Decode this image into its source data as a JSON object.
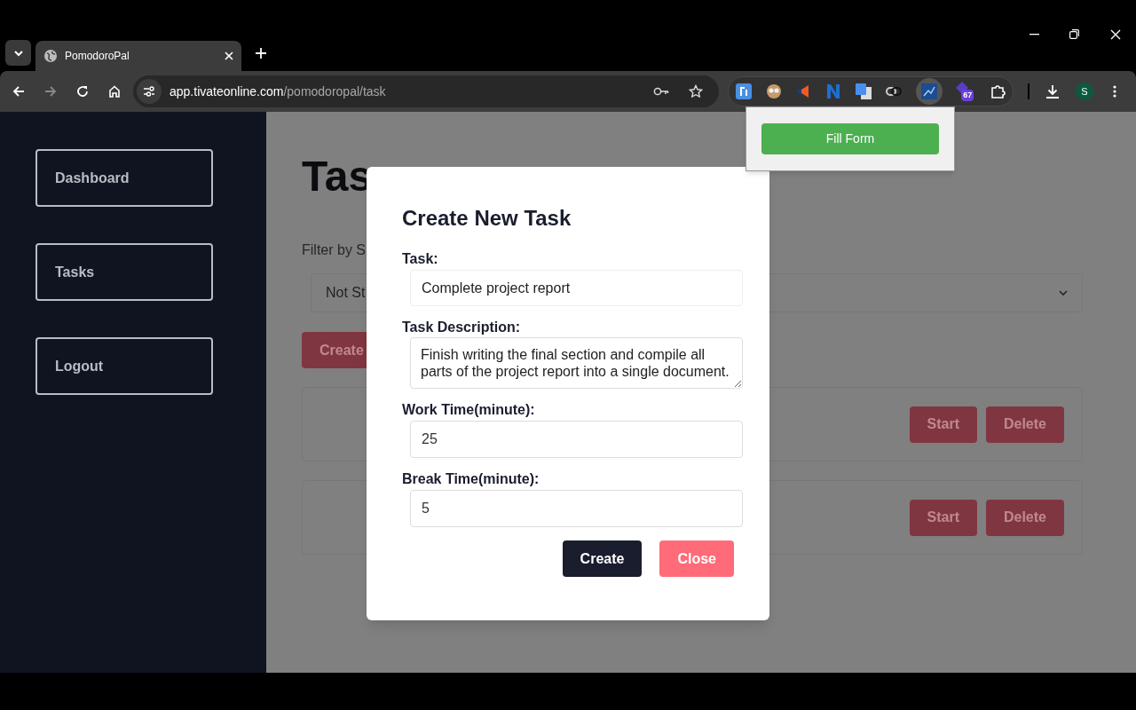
{
  "browser": {
    "tab_title": "PomodoroPal",
    "address_host": "app.tivateonline.com",
    "address_path": "/pomodoropal/task",
    "extension_badge": "67",
    "avatar": "S"
  },
  "extension_popup": {
    "button": "Fill Form"
  },
  "sidebar": {
    "items": [
      {
        "label": "Dashboard"
      },
      {
        "label": "Tasks"
      },
      {
        "label": "Logout"
      }
    ]
  },
  "main": {
    "heading": "Tas",
    "filter_label": "Filter by S",
    "filter_value": "Not St",
    "create_button": "Create",
    "task_cards": [
      {
        "buttons": [
          "Start",
          "Delete"
        ]
      },
      {
        "buttons": [
          "Start",
          "Delete"
        ]
      }
    ]
  },
  "modal": {
    "title": "Create New Task",
    "fields": [
      {
        "label": "Task:",
        "kind": "input",
        "value": "Complete project report"
      },
      {
        "label": "Task Description:",
        "kind": "textarea",
        "value": "Finish writing the final section and compile all parts of the project report into a single document."
      },
      {
        "label": "Work Time(minute):",
        "kind": "number",
        "value": "25"
      },
      {
        "label": "Break Time(minute):",
        "kind": "number",
        "value": "5"
      }
    ],
    "buttons": [
      {
        "label": "Create",
        "kind": "primary"
      },
      {
        "label": "Close",
        "kind": "danger"
      }
    ]
  }
}
